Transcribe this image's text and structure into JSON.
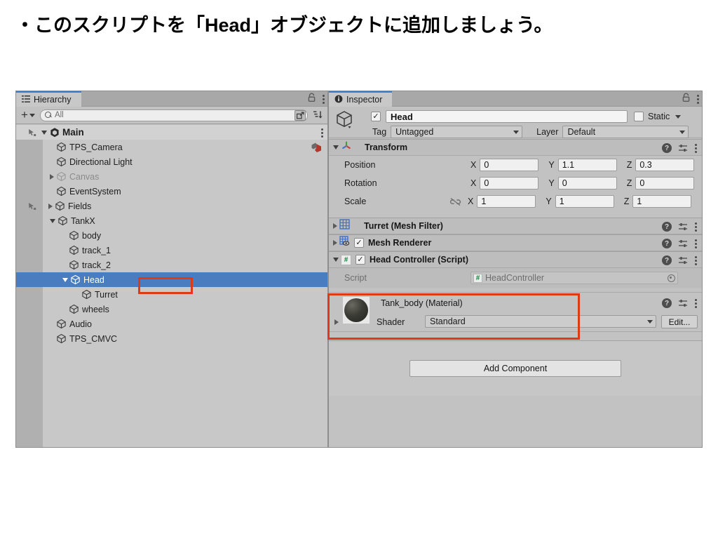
{
  "slide": {
    "title": "・このスクリプトを「Head」オブジェクトに追加しましょう。"
  },
  "hierarchy": {
    "tab_label": "Hierarchy",
    "tab_icon": "hierarchy-icon",
    "lock_icon": "lock-icon",
    "menu_icon": "kebab-menu-icon",
    "toolbar": {
      "add_label": "+",
      "add_dropdown_icon": "chevron-down-icon",
      "search_icon": "search-icon",
      "search_value": "All",
      "search_placeholder": "All",
      "popout_icon": "popout-search-icon",
      "sort_icon": "alphabetical-sort-icon"
    },
    "items": [
      {
        "label": "Main",
        "depth": 0,
        "icon": "unity-logo-icon",
        "arrow": "open",
        "type": "scene",
        "dim": false
      },
      {
        "label": "TPS_Camera",
        "depth": 2,
        "icon": "gameobject-cube-icon",
        "arrow": "none",
        "type": "object",
        "dim": false,
        "badge": "prefab-icon"
      },
      {
        "label": "Directional Light",
        "depth": 2,
        "icon": "gameobject-cube-icon",
        "arrow": "none",
        "type": "object",
        "dim": false
      },
      {
        "label": "Canvas",
        "depth": 2,
        "icon": "gameobject-cube-icon",
        "arrow": "closed",
        "type": "object",
        "dim": true
      },
      {
        "label": "EventSystem",
        "depth": 2,
        "icon": "gameobject-cube-icon",
        "arrow": "none",
        "type": "object",
        "dim": false
      },
      {
        "label": "Fields",
        "depth": 2,
        "icon": "gameobject-cube-icon",
        "arrow": "closed",
        "type": "object",
        "dim": false,
        "hand": true
      },
      {
        "label": "TankX",
        "depth": 2,
        "icon": "gameobject-cube-icon",
        "arrow": "open",
        "type": "object",
        "dim": false
      },
      {
        "label": "body",
        "depth": 3,
        "icon": "gameobject-cube-icon",
        "arrow": "none",
        "type": "object",
        "dim": false
      },
      {
        "label": "track_1",
        "depth": 3,
        "icon": "gameobject-cube-icon",
        "arrow": "none",
        "type": "object",
        "dim": false
      },
      {
        "label": "track_2",
        "depth": 3,
        "icon": "gameobject-cube-icon",
        "arrow": "none",
        "type": "object",
        "dim": false
      },
      {
        "label": "Head",
        "depth": 3,
        "icon": "gameobject-cube-icon",
        "arrow": "open",
        "type": "object",
        "dim": false,
        "selected": true,
        "highlighted": true
      },
      {
        "label": "Turret",
        "depth": 4,
        "icon": "gameobject-cube-icon",
        "arrow": "none",
        "type": "object",
        "dim": false
      },
      {
        "label": "wheels",
        "depth": 3,
        "icon": "gameobject-cube-icon",
        "arrow": "none",
        "type": "object",
        "dim": false
      },
      {
        "label": "Audio",
        "depth": 2,
        "icon": "gameobject-cube-icon",
        "arrow": "none",
        "type": "object",
        "dim": false
      },
      {
        "label": "TPS_CMVC",
        "depth": 2,
        "icon": "gameobject-cube-icon",
        "arrow": "none",
        "type": "object",
        "dim": false
      }
    ]
  },
  "inspector": {
    "tab_label": "Inspector",
    "tab_icon": "info-icon",
    "lock_icon": "lock-icon",
    "menu_icon": "kebab-menu-icon",
    "object_icon": "gameobject-cube-icon",
    "enabled_checkbox": "checked",
    "name_value": "Head",
    "static_label": "Static",
    "static_checked": false,
    "tag_label": "Tag",
    "tag_value": "Untagged",
    "layer_label": "Layer",
    "layer_value": "Default",
    "components": [
      {
        "name": "Transform",
        "icon": "transform-axis-icon",
        "expanded": true,
        "has_enable_checkbox": false,
        "properties": [
          {
            "label": "Position",
            "x": "0",
            "y": "1.1",
            "z": "0.3",
            "link_icon": false
          },
          {
            "label": "Rotation",
            "x": "0",
            "y": "0",
            "z": "0",
            "link_icon": false
          },
          {
            "label": "Scale",
            "x": "1",
            "y": "1",
            "z": "1",
            "link_icon": true
          }
        ],
        "axis_labels": [
          "X",
          "Y",
          "Z"
        ]
      },
      {
        "name": "Turret (Mesh Filter)",
        "icon": "mesh-filter-grid-icon",
        "expanded": false,
        "has_enable_checkbox": false
      },
      {
        "name": "Mesh Renderer",
        "icon": "mesh-renderer-grid-icon",
        "expanded": false,
        "has_enable_checkbox": true,
        "enabled": true
      },
      {
        "name": "Head Controller (Script)",
        "icon": "csharp-script-icon",
        "expanded": true,
        "has_enable_checkbox": true,
        "enabled": true,
        "highlighted": true,
        "script_field": {
          "label": "Script",
          "value": "HeadController",
          "badge": "csharp-script-icon",
          "picker_icon": "object-picker-icon"
        }
      }
    ],
    "material": {
      "title": "Tank_body (Material)",
      "preview_icon": "material-sphere-preview",
      "foldout_icon": "chevron-right-icon",
      "shader_label": "Shader",
      "shader_value": "Standard",
      "edit_label": "Edit...",
      "help_icon": "help-icon",
      "preset_icon": "preset-icon",
      "menu_icon": "kebab-menu-icon"
    },
    "add_component_label": "Add Component",
    "component_tools": {
      "help_icon": "help-icon",
      "preset_icon": "preset-icon",
      "menu_icon": "kebab-menu-icon"
    }
  },
  "annotations": {
    "highlight_color": "#dd3b17",
    "selection_color": "#4a7cc0"
  }
}
